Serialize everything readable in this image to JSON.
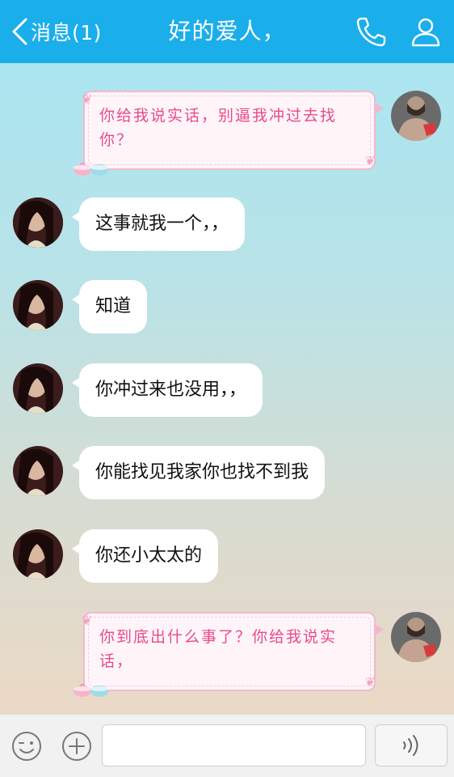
{
  "header": {
    "back_label": "消息(1)",
    "title": "好的爱人，",
    "call_icon": "phone-icon",
    "profile_icon": "person-icon",
    "background": "#1aaeea"
  },
  "messages": [
    {
      "side": "out",
      "text": "你给我说实话，别逼我冲过去找你？"
    },
    {
      "side": "in",
      "text": "这事就我一个，，"
    },
    {
      "side": "in",
      "text": "知道"
    },
    {
      "side": "in",
      "text": "你冲过来也没用，，"
    },
    {
      "side": "in",
      "text": "你能找见我家你也找不到我"
    },
    {
      "side": "in",
      "text": "你还小太太的"
    },
    {
      "side": "out",
      "text": "你到底出什么事了？你给我说实话，"
    }
  ],
  "input": {
    "placeholder": "",
    "emoji_icon": "emoji-icon",
    "plus_icon": "plus-icon",
    "voice_icon": "voice-icon"
  },
  "colors": {
    "out_text": "#e8498e",
    "out_border": "#f3b8cd",
    "in_bubble": "#ffffff"
  }
}
